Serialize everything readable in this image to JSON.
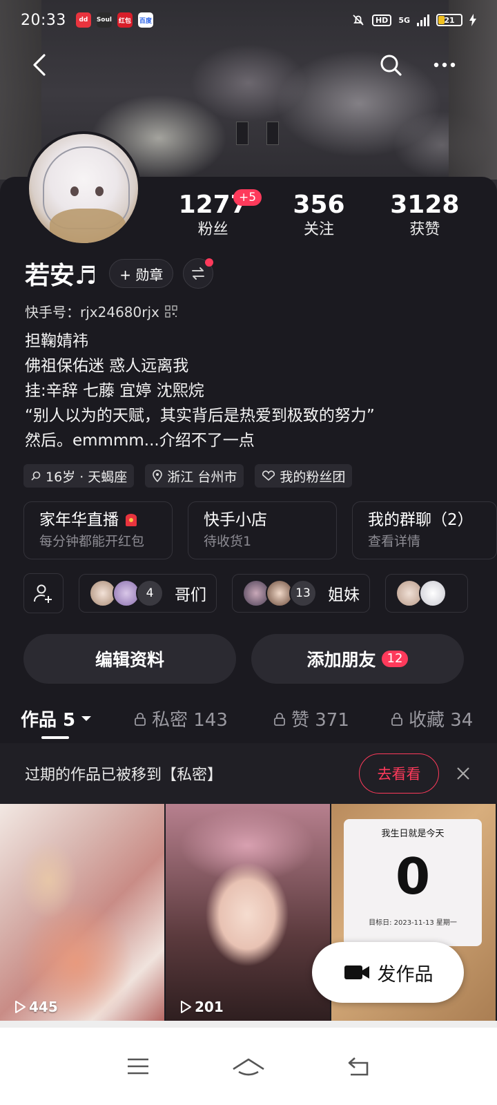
{
  "status_bar": {
    "time": "20:33",
    "apps": [
      "dd",
      "Soul",
      "红包",
      "百度"
    ],
    "hd": "HD",
    "network": "5G",
    "battery": "21"
  },
  "profile": {
    "name": "若安♬",
    "medal_button": "+ 勋章",
    "kuaishou_id": "快手号：rjx24680rjx",
    "stats": [
      {
        "num": "1277",
        "label": "粉丝",
        "badge": "+5"
      },
      {
        "num": "356",
        "label": "关注"
      },
      {
        "num": "3128",
        "label": "获赞"
      }
    ],
    "bio": [
      "担鞠婧祎",
      "佛祖保佑迷 惑人远离我",
      "挂:辛辞  七藤  宜婷  沈熙烷",
      "“别人以为的天赋，其实背后是热爱到极致的努力”",
      "然后。emmmm...介绍不了一点"
    ],
    "tags": [
      "16岁 · 天蝎座",
      "浙江 台州市",
      "我的粉丝团"
    ]
  },
  "cards": [
    {
      "title": "家年华直播",
      "sub": "每分钟都能开红包"
    },
    {
      "title": "快手小店",
      "sub": "待收货1"
    },
    {
      "title": "我的群聊（2）",
      "sub": "查看详情"
    }
  ],
  "groups": [
    {
      "count": "4",
      "name": "哥们"
    },
    {
      "count": "13",
      "name": "姐妹"
    }
  ],
  "actions": {
    "edit": "编辑资料",
    "add_friend": "添加朋友",
    "add_friend_badge": "12"
  },
  "tabs": [
    {
      "label": "作品 5",
      "active": true
    },
    {
      "label": "私密 143"
    },
    {
      "label": "赞 371"
    },
    {
      "label": "收藏 34"
    }
  ],
  "notice": {
    "text": "过期的作品已被移到【私密】",
    "button": "去看看"
  },
  "works": [
    {
      "plays": "445"
    },
    {
      "plays": "201"
    },
    {
      "countdown_title": "我生日就是今天",
      "countdown_num": "0",
      "countdown_date": "目标日: 2023-11-13 星期一"
    }
  ],
  "fab": {
    "label": "发作品"
  }
}
